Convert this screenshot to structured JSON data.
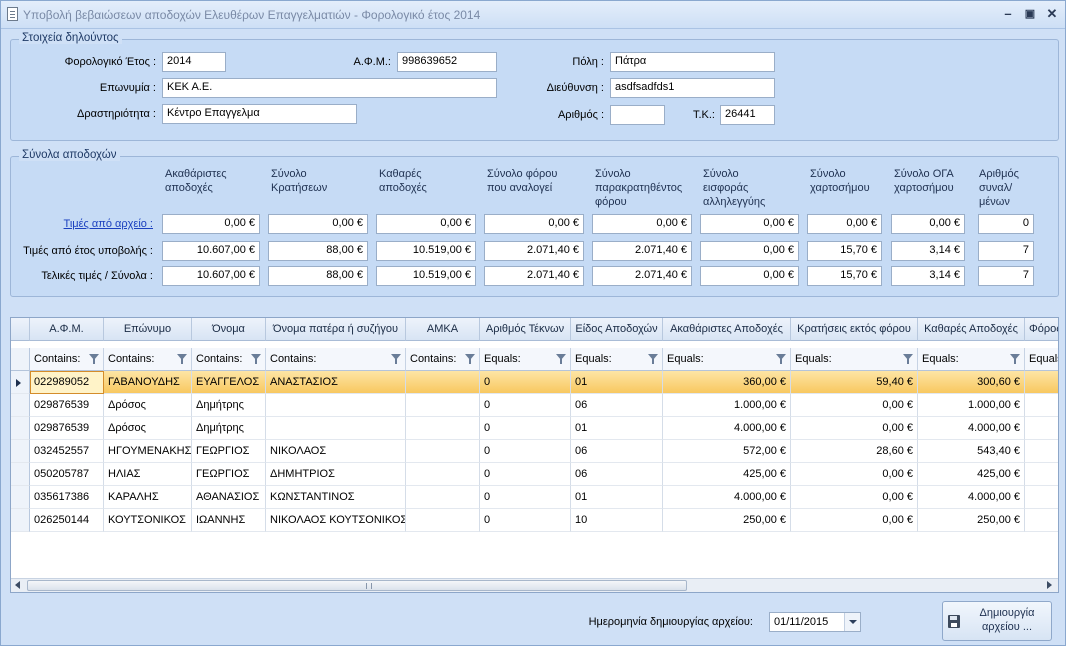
{
  "window": {
    "title": "Υποβολή βεβαιώσεων αποδοχών Ελευθέρων Επαγγελματιών - Φορολογικό έτος 2014"
  },
  "declarant": {
    "legend": "Στοιχεία δηλούντος",
    "year_label": "Φορολογικό Έτος :",
    "year_value": "2014",
    "afm_label": "Α.Φ.Μ.:",
    "afm_value": "998639652",
    "city_label": "Πόλη :",
    "city_value": "Πάτρα",
    "name_label": "Επωνυμία :",
    "name_value": "ΚΕΚ Α.Ε.",
    "address_label": "Διεύθυνση :",
    "address_value": "asdfsadfds1",
    "activity_label": "Δραστηριότητα :",
    "activity_value": "Κέντρο Επαγγελμα",
    "number_label": "Αριθμός :",
    "number_value": "",
    "tk_label": "Τ.Κ.:",
    "tk_value": "26441"
  },
  "totals": {
    "legend": "Σύνολα αποδοχών",
    "columns": [
      "Ακαθάριστες\nαποδοχές",
      "Σύνολο\nΚρατήσεων",
      "Καθαρές\nαποδοχές",
      "Σύνολο φόρου\nπου αναλογεί",
      "Σύνολο\nπαρακρατηθέντος\nφόρου",
      "Σύνολο\nεισφοράς\nαλληλεγγύης",
      "Σύνολο\nχαρτοσήμου",
      "Σύνολο ΟΓΑ\nχαρτοσήμου",
      "Αριθμός\nσυναλ/μένων"
    ],
    "rows": [
      {
        "label": "Τιμές από αρχείο :",
        "values": [
          "0,00 €",
          "0,00 €",
          "0,00 €",
          "0,00 €",
          "0,00 €",
          "0,00 €",
          "0,00 €",
          "0,00 €",
          "0"
        ]
      },
      {
        "label": "Τιμές από έτος υποβολής :",
        "values": [
          "10.607,00 €",
          "88,00 €",
          "10.519,00 €",
          "2.071,40 €",
          "2.071,40 €",
          "0,00 €",
          "15,70 €",
          "3,14 €",
          "7"
        ]
      },
      {
        "label": "Τελικές τιμές / Σύνολα :",
        "values": [
          "10.607,00 €",
          "88,00 €",
          "10.519,00 €",
          "2.071,40 €",
          "2.071,40 €",
          "0,00 €",
          "15,70 €",
          "3,14 €",
          "7"
        ]
      }
    ]
  },
  "grid": {
    "columns": [
      "Α.Φ.Μ.",
      "Επώνυμο",
      "Όνομα",
      "Όνομα πατέρα ή συζήγου",
      "ΑΜΚΑ",
      "Αριθμός Τέκνων",
      "Είδος Αποδοχών",
      "Ακαθάριστες Αποδοχές",
      "Κρατήσεις εκτός φόρου",
      "Καθαρές Αποδοχές",
      "Φόρος"
    ],
    "filters": [
      "Contains:",
      "Contains:",
      "Contains:",
      "Contains:",
      "Contains:",
      "Equals:",
      "Equals:",
      "Equals:",
      "Equals:",
      "Equals:",
      "Equals:"
    ],
    "rows": [
      [
        "022989052",
        "ΓΑΒΑΝΟΥΔΗΣ",
        "ΕΥΑΓΓΕΛΟΣ",
        "ΑΝΑΣΤΑΣΙΟΣ",
        "",
        "0",
        "01",
        "360,00 €",
        "59,40 €",
        "300,60 €",
        ""
      ],
      [
        "029876539",
        "Δρόσος",
        "Δημήτρης",
        "",
        "",
        "0",
        "06",
        "1.000,00 €",
        "0,00 €",
        "1.000,00 €",
        ""
      ],
      [
        "029876539",
        "Δρόσος",
        "Δημήτρης",
        "",
        "",
        "0",
        "01",
        "4.000,00 €",
        "0,00 €",
        "4.000,00 €",
        ""
      ],
      [
        "032452557",
        "ΗΓΟΥΜΕΝΑΚΗΣ",
        "ΓΕΩΡΓΙΟΣ",
        "ΝΙΚΟΛΑΟΣ",
        "",
        "0",
        "06",
        "572,00 €",
        "28,60 €",
        "543,40 €",
        ""
      ],
      [
        "050205787",
        "ΗΛΙΑΣ",
        "ΓΕΩΡΓΙΟΣ",
        "ΔΗΜΗΤΡΙΟΣ",
        "",
        "0",
        "06",
        "425,00 €",
        "0,00 €",
        "425,00 €",
        ""
      ],
      [
        "035617386",
        "ΚΑΡΑΛΗΣ",
        "ΑΘΑΝΑΣΙΟΣ",
        "ΚΩΝΣΤΑΝΤΙΝΟΣ",
        "",
        "0",
        "01",
        "4.000,00 €",
        "0,00 €",
        "4.000,00 €",
        ""
      ],
      [
        "026250144",
        "ΚΟΥΤΣΟΝΙΚΟΣ",
        "ΙΩΑΝΝΗΣ",
        "ΝΙΚΟΛΑΟΣ ΚΟΥΤΣΟΝΙΚΟΣ",
        "",
        "0",
        "10",
        "250,00 €",
        "0,00 €",
        "250,00 €",
        ""
      ]
    ],
    "selected_row": 0
  },
  "footer": {
    "date_label": "Ημερομηνία δημιουργίας αρχείου:",
    "date_value": "01/11/2015",
    "create_button": "Δημιουργία αρχείου ..."
  }
}
